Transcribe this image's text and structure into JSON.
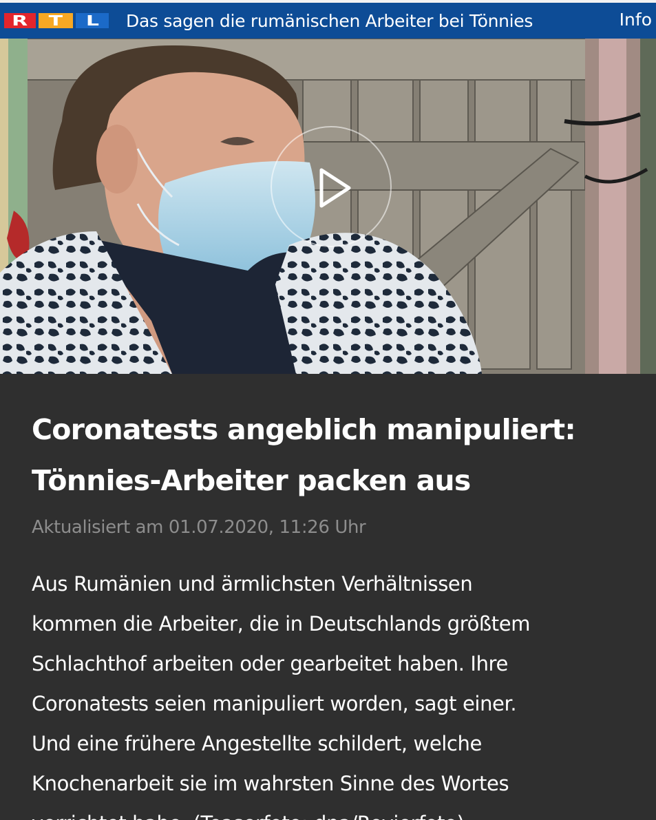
{
  "topbar": {
    "logo_letters": [
      "R",
      "T",
      "L"
    ],
    "title": "Das sagen die rumänischen Arbeiter bei Tönnies",
    "info_label": "Info"
  },
  "video": {
    "play_icon": "play-icon"
  },
  "article": {
    "headline_lines": [
      "Coronatests angeblich manipuliert:",
      "Tönnies-Arbeiter packen aus"
    ],
    "timestamp": "Aktualisiert am 01.07.2020, 11:26 Uhr",
    "teaser_lines": [
      "Aus Rumänien und ärmlichsten Verhältnissen",
      "kommen die Arbeiter, die in Deutschlands größtem",
      "Schlachthof arbeiten oder gearbeitet haben. Ihre",
      "Coronatests seien manipuliert worden, sagt einer.",
      "Und eine frühere Angestellte schildert, welche",
      "Knochenarbeit sie im wahrsten Sinne des Wortes",
      "verrichtet habe. (Teaserfoto: dpa/Revierfoto)"
    ]
  },
  "colors": {
    "topbar_bg": "#0d4c96",
    "logo_r": "#e3252c",
    "logo_t": "#f7a823",
    "logo_l": "#1b6ac8",
    "article_bg": "#2f2f2f",
    "timestamp": "#8d8d8d"
  }
}
